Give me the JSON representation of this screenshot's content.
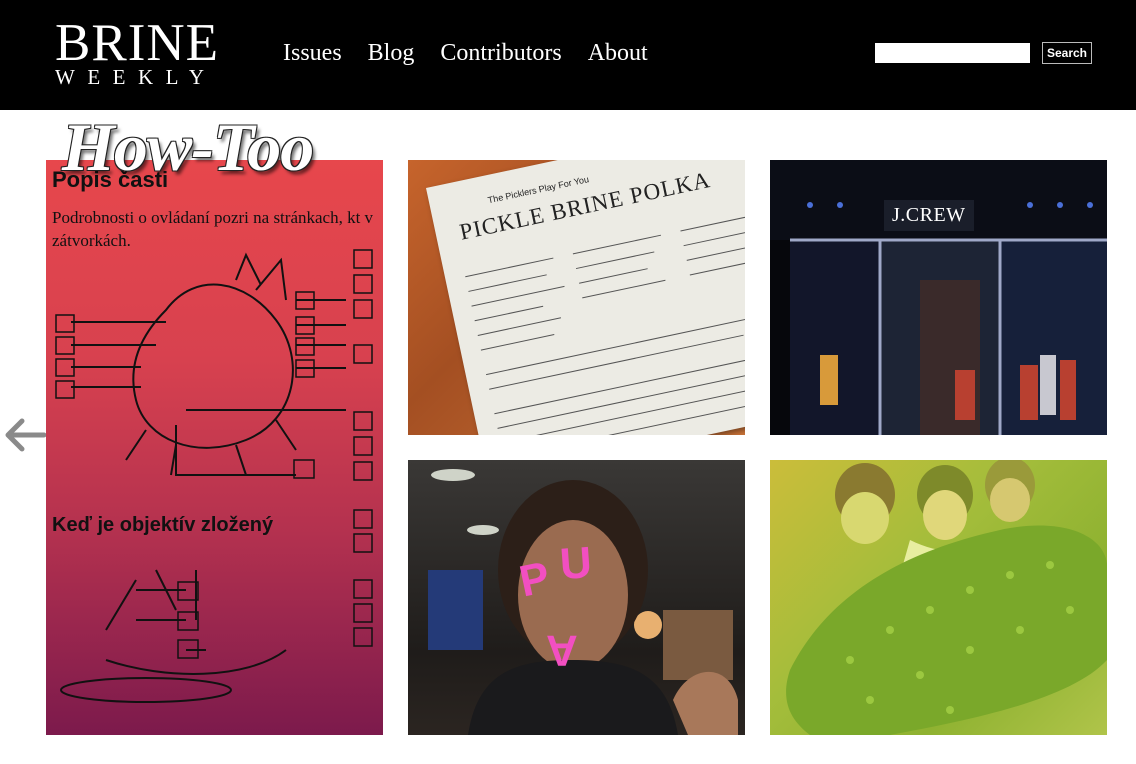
{
  "site": {
    "logo_main": "BRINE",
    "logo_sub": "WEEKLY"
  },
  "nav": {
    "items": [
      {
        "label": "Issues"
      },
      {
        "label": "Blog"
      },
      {
        "label": "Contributors"
      },
      {
        "label": "About"
      }
    ]
  },
  "search": {
    "value": "",
    "button_label": "Search"
  },
  "section": {
    "title": "How-Too"
  },
  "arrows": {
    "prev_icon": "arrow-left-icon"
  },
  "tiles": [
    {
      "heading": "Popis časti",
      "text": "Podrobnosti o ovládaní pozri na stránkach, kt v zátvorkách.",
      "heading2": "Keď je objektív zložený"
    },
    {
      "small_text": "The Picklers Play For You",
      "title": "PICKLE BRINE POLKA"
    },
    {
      "sign": "J.CREW"
    },
    {
      "letters": [
        "P",
        "U",
        "A"
      ]
    },
    {}
  ],
  "colors": {
    "header_bg": "#000000",
    "pua_pink": "#f24fc1"
  }
}
